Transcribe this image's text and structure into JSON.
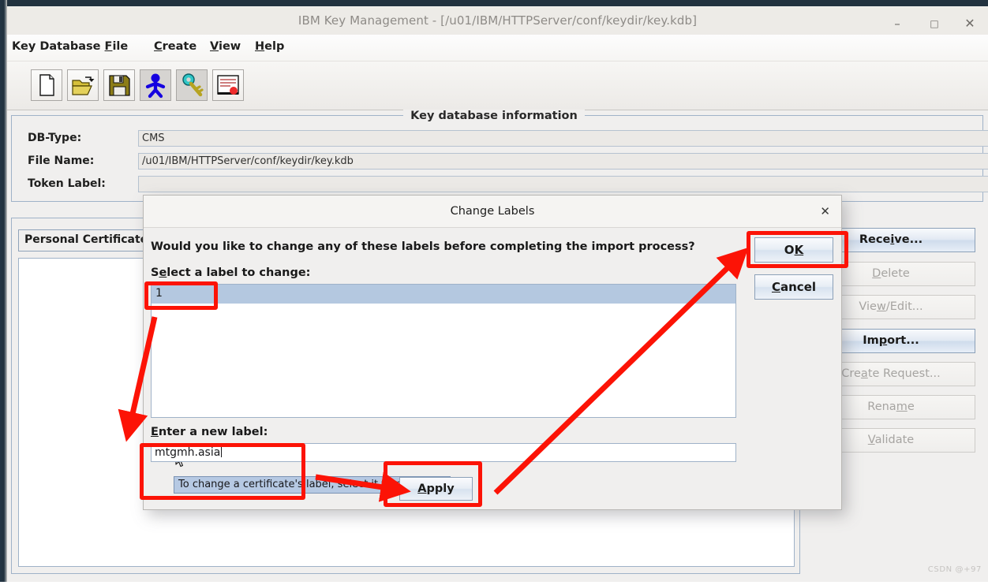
{
  "window": {
    "title": "IBM Key Management - [/u01/IBM/HTTPServer/conf/keydir/key.kdb]",
    "minimize_icon": "minimize-icon",
    "maximize_icon": "maximize-icon",
    "close_icon": "close-icon",
    "minimize_glyph": "–",
    "maximize_glyph": "□",
    "close_glyph": "✕"
  },
  "menubar": {
    "items": [
      {
        "label": "Key Database File",
        "mnemonic": "F",
        "pre": "Key Database ",
        "post": "ile"
      },
      {
        "label": "Create",
        "mnemonic": "C",
        "pre": "",
        "post": "reate"
      },
      {
        "label": "View",
        "mnemonic": "V",
        "pre": "",
        "post": "iew"
      },
      {
        "label": "Help",
        "mnemonic": "H",
        "pre": "",
        "post": "elp"
      }
    ]
  },
  "toolbar": {
    "buttons": [
      {
        "name": "new-file-icon",
        "tip": "New"
      },
      {
        "name": "open-folder-icon",
        "tip": "Open"
      },
      {
        "name": "save-floppy-icon",
        "tip": "Save"
      },
      {
        "name": "person-blue-icon",
        "tip": "Personal Certificates"
      },
      {
        "name": "key-icon",
        "tip": "Key"
      },
      {
        "name": "certificate-seal-icon",
        "tip": "Certificate"
      }
    ]
  },
  "key_database_information": {
    "group_title": "Key database information",
    "rows": [
      {
        "label": "DB-Type:",
        "value": "CMS"
      },
      {
        "label": "File Name:",
        "value": "/u01/IBM/HTTPServer/conf/keydir/key.kdb"
      },
      {
        "label": "Token Label:",
        "value": ""
      }
    ]
  },
  "certificates": {
    "selector_label": "Personal Certificates",
    "list_items": []
  },
  "side_buttons": [
    {
      "label": "Receive...",
      "pre": "Rece",
      "mnemonic": "i",
      "post": "ve...",
      "enabled": true
    },
    {
      "label": "Delete",
      "pre": "",
      "mnemonic": "D",
      "post": "elete",
      "enabled": false
    },
    {
      "label": "View/Edit...",
      "pre": "Vie",
      "mnemonic": "w",
      "post": "/Edit...",
      "enabled": false
    },
    {
      "label": "Import...",
      "pre": "Im",
      "mnemonic": "p",
      "post": "ort...",
      "enabled": true
    },
    {
      "label": "Create Request...",
      "pre": "Cre",
      "mnemonic": "a",
      "post": "te Request...",
      "enabled": false
    },
    {
      "label": "Rename",
      "pre": "Rena",
      "mnemonic": "m",
      "post": "e",
      "enabled": false
    },
    {
      "label": "Validate",
      "pre": "",
      "mnemonic": "V",
      "post": "alidate",
      "enabled": false
    }
  ],
  "dialog": {
    "title": "Change Labels",
    "close_glyph": "✕",
    "question": "Would you like to change any of these labels before completing the import process?",
    "select_label_pre": "S",
    "select_label_mnemonic": "e",
    "select_label_post": "lect a label to change:",
    "select_label": "Select a label to change:",
    "list_items": [
      "1"
    ],
    "selected_list_item": "1",
    "tooltip": "To change a certificate's label, select it from this list",
    "new_label_pre": "",
    "new_label_mnemonic": "E",
    "new_label_post": "nter a new label:",
    "new_label_heading": "Enter a new label:",
    "new_label_value": "mtgmh.asia",
    "apply_pre": "",
    "apply_mnemonic": "A",
    "apply_post": "pply",
    "apply_label": "Apply",
    "ok_pre": "O",
    "ok_mnemonic": "K",
    "ok_label": "OK",
    "cancel_pre": "",
    "cancel_mnemonic": "C",
    "cancel_post": "ancel",
    "cancel_label": "Cancel"
  },
  "annotation": {
    "color": "#fc1306",
    "highlight_boxes": [
      "list-item-1",
      "new-label-input",
      "apply-button",
      "ok-button"
    ],
    "arrows": [
      "list-item-to-new-label",
      "new-label-to-apply",
      "apply-to-ok"
    ]
  },
  "watermark": {
    "text": "CSDN @+97"
  }
}
